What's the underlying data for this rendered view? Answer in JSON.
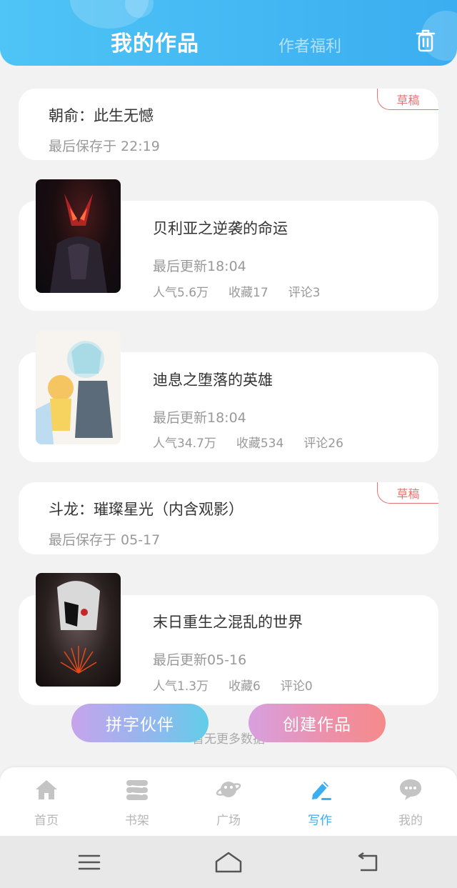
{
  "header": {
    "tab_works": "我的作品",
    "tab_benefits": "作者福利",
    "trash_icon": "trash-icon"
  },
  "works": [
    {
      "kind": "draft",
      "title": "朝俞：此生无憾",
      "saved": "最后保存于 22:19",
      "badge": "草稿"
    },
    {
      "kind": "book",
      "title": "贝利亚之逆袭的命运",
      "updated": "最后更新18:04",
      "popularity": "人气5.6万",
      "favorites": "收藏17",
      "comments": "评论3"
    },
    {
      "kind": "book",
      "title": "迪息之堕落的英雄",
      "updated": "最后更新18:04",
      "popularity": "人气34.7万",
      "favorites": "收藏534",
      "comments": "评论26"
    },
    {
      "kind": "draft",
      "title": "斗龙：璀璨星光（内含观影）",
      "saved": "最后保存于 05-17",
      "badge": "草稿"
    },
    {
      "kind": "book",
      "title": "末日重生之混乱的世界",
      "updated": "最后更新05-16",
      "popularity": "人气1.3万",
      "favorites": "收藏6",
      "comments": "评论0"
    }
  ],
  "footer_text": "暂无更多数据",
  "actions": {
    "partner_label": "拼字伙伴",
    "create_label": "创建作品"
  },
  "tabbar": [
    {
      "label": "首页",
      "icon": "home-icon"
    },
    {
      "label": "书架",
      "icon": "bookshelf-icon"
    },
    {
      "label": "广场",
      "icon": "planet-icon"
    },
    {
      "label": "写作",
      "icon": "pen-icon",
      "active": true
    },
    {
      "label": "我的",
      "icon": "chat-bubble-icon"
    }
  ],
  "colors": {
    "accent": "#3aaef0",
    "draft_badge": "#e57373",
    "muted_text": "#999999"
  }
}
